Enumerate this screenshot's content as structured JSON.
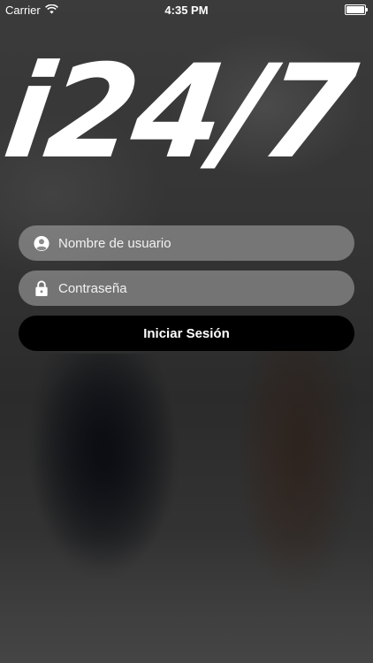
{
  "status_bar": {
    "carrier": "Carrier",
    "time": "4:35 PM",
    "wifi_icon": "wifi-icon",
    "battery_icon": "battery-icon"
  },
  "logo": {
    "text": "i24/7"
  },
  "login": {
    "username_placeholder": "Nombre de usuario",
    "username_value": "",
    "username_icon": "user-circle-icon",
    "password_placeholder": "Contraseña",
    "password_value": "",
    "password_icon": "lock-icon",
    "submit_label": "Iniciar Sesión"
  },
  "colors": {
    "button_bg": "#000000",
    "field_bg": "rgba(200,200,200,0.45)",
    "text": "#ffffff"
  }
}
